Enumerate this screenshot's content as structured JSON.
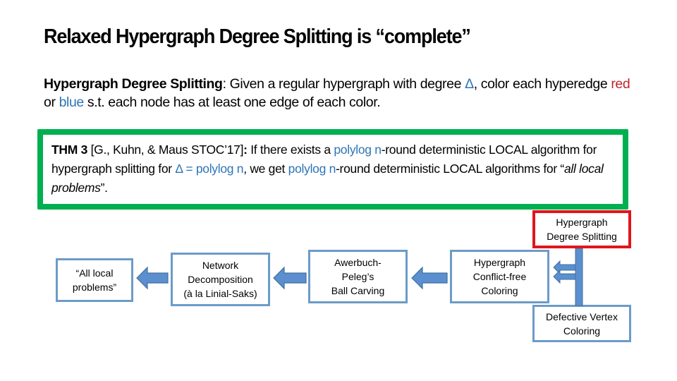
{
  "slide": {
    "title": "Relaxed Hypergraph Degree Splitting is “complete”",
    "definition": {
      "term": "Hypergraph Degree Splitting",
      "part1": ": Given a regular hypergraph with degree ",
      "delta": "Δ",
      "part2": ", color each hyperedge ",
      "red_word": "red",
      "part3": " or ",
      "blue_word": "blue",
      "part4": " s.t. each node has at least one edge of each color."
    },
    "theorem": {
      "label": "THM 3",
      "citation": " [G., Kuhn, & Maus STOC’17]",
      "colon": ":",
      "part1": " If there exists a ",
      "hl1": "polylog n",
      "part2": "-round deterministic LOCAL algorithm for hypergraph splitting for ",
      "hl2": "Δ = polylog n",
      "part3": ", we get ",
      "hl3": "polylog n",
      "part4": "-round deterministic LOCAL algorithms for “",
      "italic": "all local problems",
      "part5": "”."
    },
    "colors": {
      "theorem_border": "#00b050",
      "highlight_box_border": "#e0161c",
      "box_border": "#6c9bc8",
      "arrow_fill": "#5b8fcf",
      "red_text": "#c0262d",
      "blue_text": "#2e75b6"
    }
  },
  "diagram": {
    "nodes": [
      {
        "id": "all-local-problems",
        "label": "“All local\nproblems”"
      },
      {
        "id": "network-decomposition",
        "label": "Network\nDecomposition\n(à la Linial-Saks)"
      },
      {
        "id": "ball-carving",
        "label": "Awerbuch-\nPeleg’s\nBall Carving"
      },
      {
        "id": "conflict-free-coloring",
        "label": "Hypergraph\nConflict-free\nColoring"
      },
      {
        "id": "degree-splitting",
        "label": "Hypergraph\nDegree Splitting"
      },
      {
        "id": "defective-coloring",
        "label": "Defective Vertex\nColoring"
      }
    ]
  }
}
